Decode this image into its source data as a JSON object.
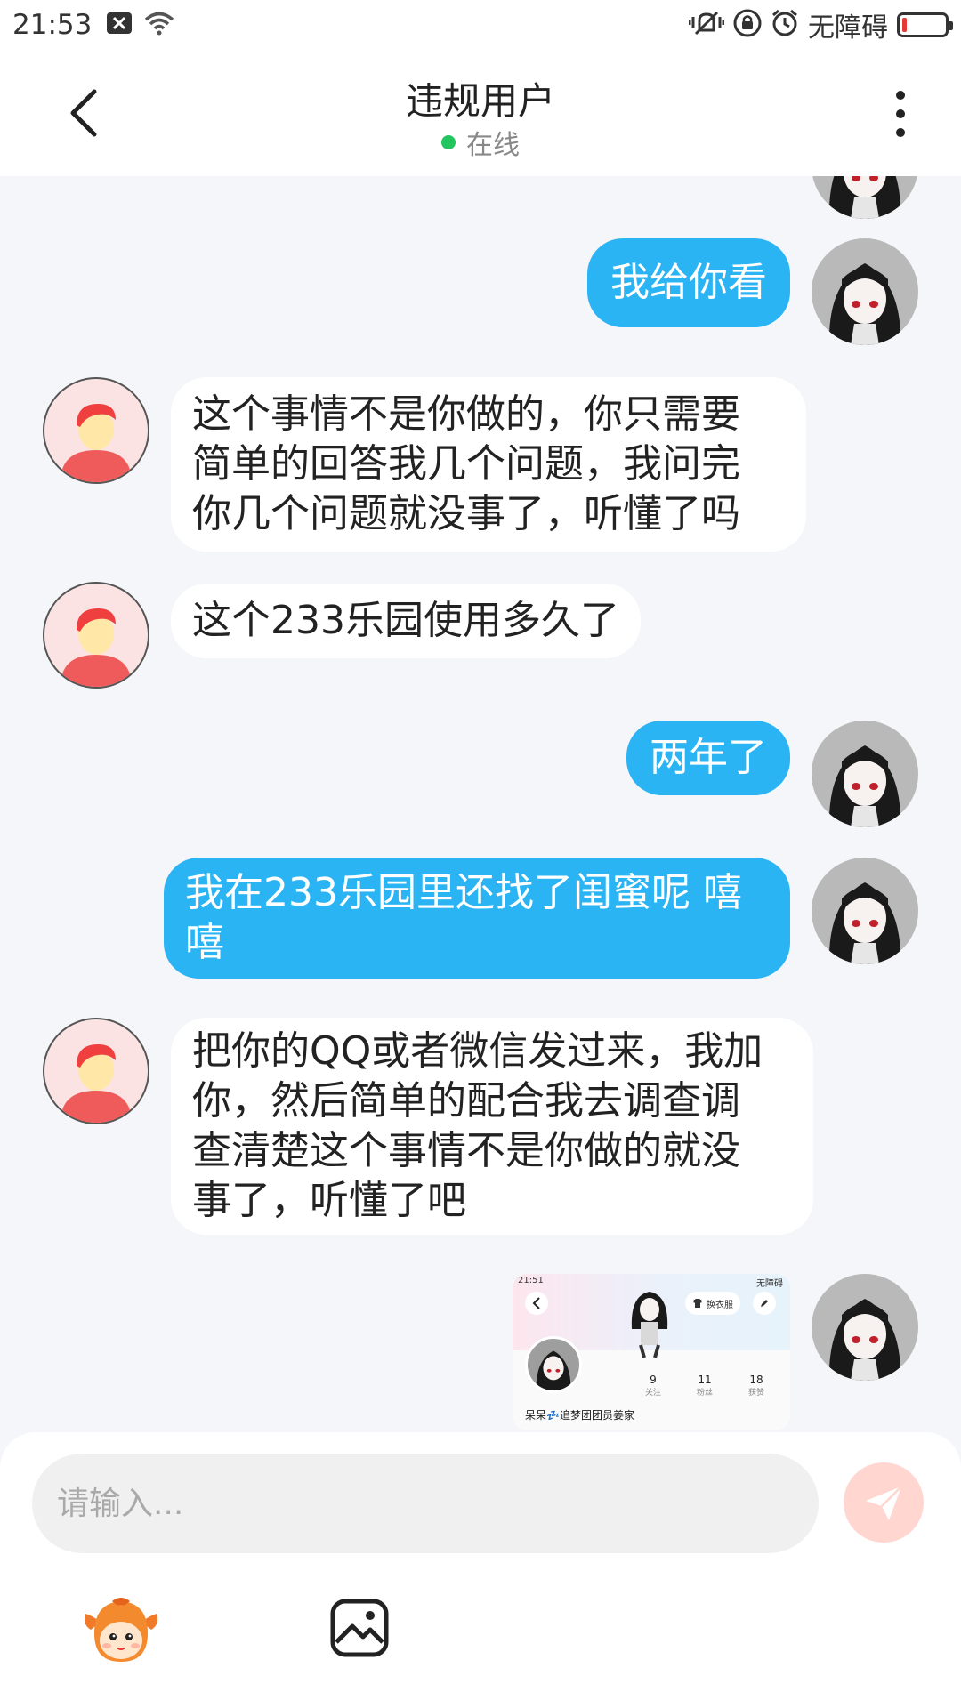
{
  "status_bar": {
    "time": "21:53",
    "accessibility_text": "无障碍",
    "left_icons": [
      "close-box-icon",
      "wifi-icon"
    ],
    "right_icons": [
      "vibrate-icon",
      "lock-rotation-icon",
      "alarm-icon",
      "battery-low-icon"
    ]
  },
  "header": {
    "title": "违规用户",
    "status": "在线",
    "status_color": "#22c55e"
  },
  "messages": [
    {
      "from": "me",
      "text": "我给你看"
    },
    {
      "from": "peer",
      "lines": [
        "这个事情不是你做的，你只需要",
        "简单的回答我几个问题，我问完",
        "你几个问题就没事了，听懂了吗"
      ]
    },
    {
      "from": "peer",
      "text": "这个233乐园使用多久了"
    },
    {
      "from": "me",
      "text": "两年了"
    },
    {
      "from": "me",
      "lines": [
        "我在233乐园里还找了闺蜜呢 嘻",
        "嘻"
      ]
    },
    {
      "from": "peer",
      "lines": [
        "把你的QQ或者微信发过来，我加",
        "你，然后简单的配合我去调查调",
        "查清楚这个事情不是你做的就没",
        "事了，听懂了吧"
      ]
    },
    {
      "from": "me",
      "type": "image",
      "screenshot": {
        "time": "21:51",
        "accessibility_text": "无障碍",
        "outfit_button": "换衣服",
        "stats": [
          {
            "value": "9",
            "label": "关注"
          },
          {
            "value": "11",
            "label": "粉丝"
          },
          {
            "value": "18",
            "label": "获赞"
          }
        ],
        "username": "呆呆💤追梦团团员姜家"
      }
    }
  ],
  "input": {
    "placeholder": "请输入..."
  },
  "colors": {
    "my_bubble": "#2bb4f3",
    "peer_bubble": "#ffffff",
    "chat_background": "#f4f6f9",
    "send_button": "#ffd6d0"
  }
}
